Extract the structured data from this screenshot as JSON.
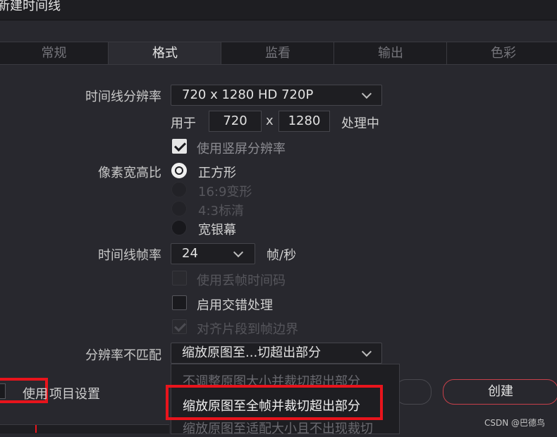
{
  "window": {
    "title": "新建时间线"
  },
  "tabs": [
    {
      "label": "常规"
    },
    {
      "label": "格式"
    },
    {
      "label": "监看"
    },
    {
      "label": "输出"
    },
    {
      "label": "色彩"
    }
  ],
  "resolution": {
    "label": "时间线分辨率",
    "value": "720 x 1280 HD 720P"
  },
  "dimensions": {
    "prefix": "用于",
    "width": "720",
    "separator": "x",
    "height": "1280",
    "suffix": "处理中"
  },
  "portrait": {
    "label": "使用竖屏分辨率",
    "checked": true
  },
  "pixel_aspect": {
    "label": "像素宽高比",
    "options": [
      {
        "label": "正方形",
        "selected": true,
        "enabled": true
      },
      {
        "label": "16:9变形",
        "selected": false,
        "enabled": false
      },
      {
        "label": "4:3标清",
        "selected": false,
        "enabled": false
      },
      {
        "label": "宽银幕",
        "selected": false,
        "enabled": true
      }
    ]
  },
  "frame_rate": {
    "label": "时间线帧率",
    "value": "24",
    "unit": "帧/秒"
  },
  "drop_frame": {
    "label": "使用丢帧时间码",
    "checked": false,
    "enabled": false
  },
  "interlace": {
    "label": "启用交错处理",
    "checked": false,
    "enabled": true
  },
  "conform": {
    "label": "对齐片段到帧边界",
    "checked": true,
    "enabled": false
  },
  "mismatch": {
    "label": "分辨率不匹配",
    "value": "缩放原图至...切超出部分",
    "options": [
      {
        "label": "不调整原图大小并裁切超出部分",
        "highlighted": false
      },
      {
        "label": "缩放原图至全帧并裁切超出部分",
        "highlighted": true
      },
      {
        "label": "缩放原图至适配大小且不出现裁切",
        "highlighted": false
      }
    ]
  },
  "project_settings": {
    "label_a": "使用",
    "label_b": "项目设置"
  },
  "create_button": {
    "label": "创建"
  },
  "watermark": "CSDN @巴德鸟",
  "colors": {
    "highlight": "#e8141c",
    "create_border": "#c8404a",
    "background": "#28282e"
  }
}
